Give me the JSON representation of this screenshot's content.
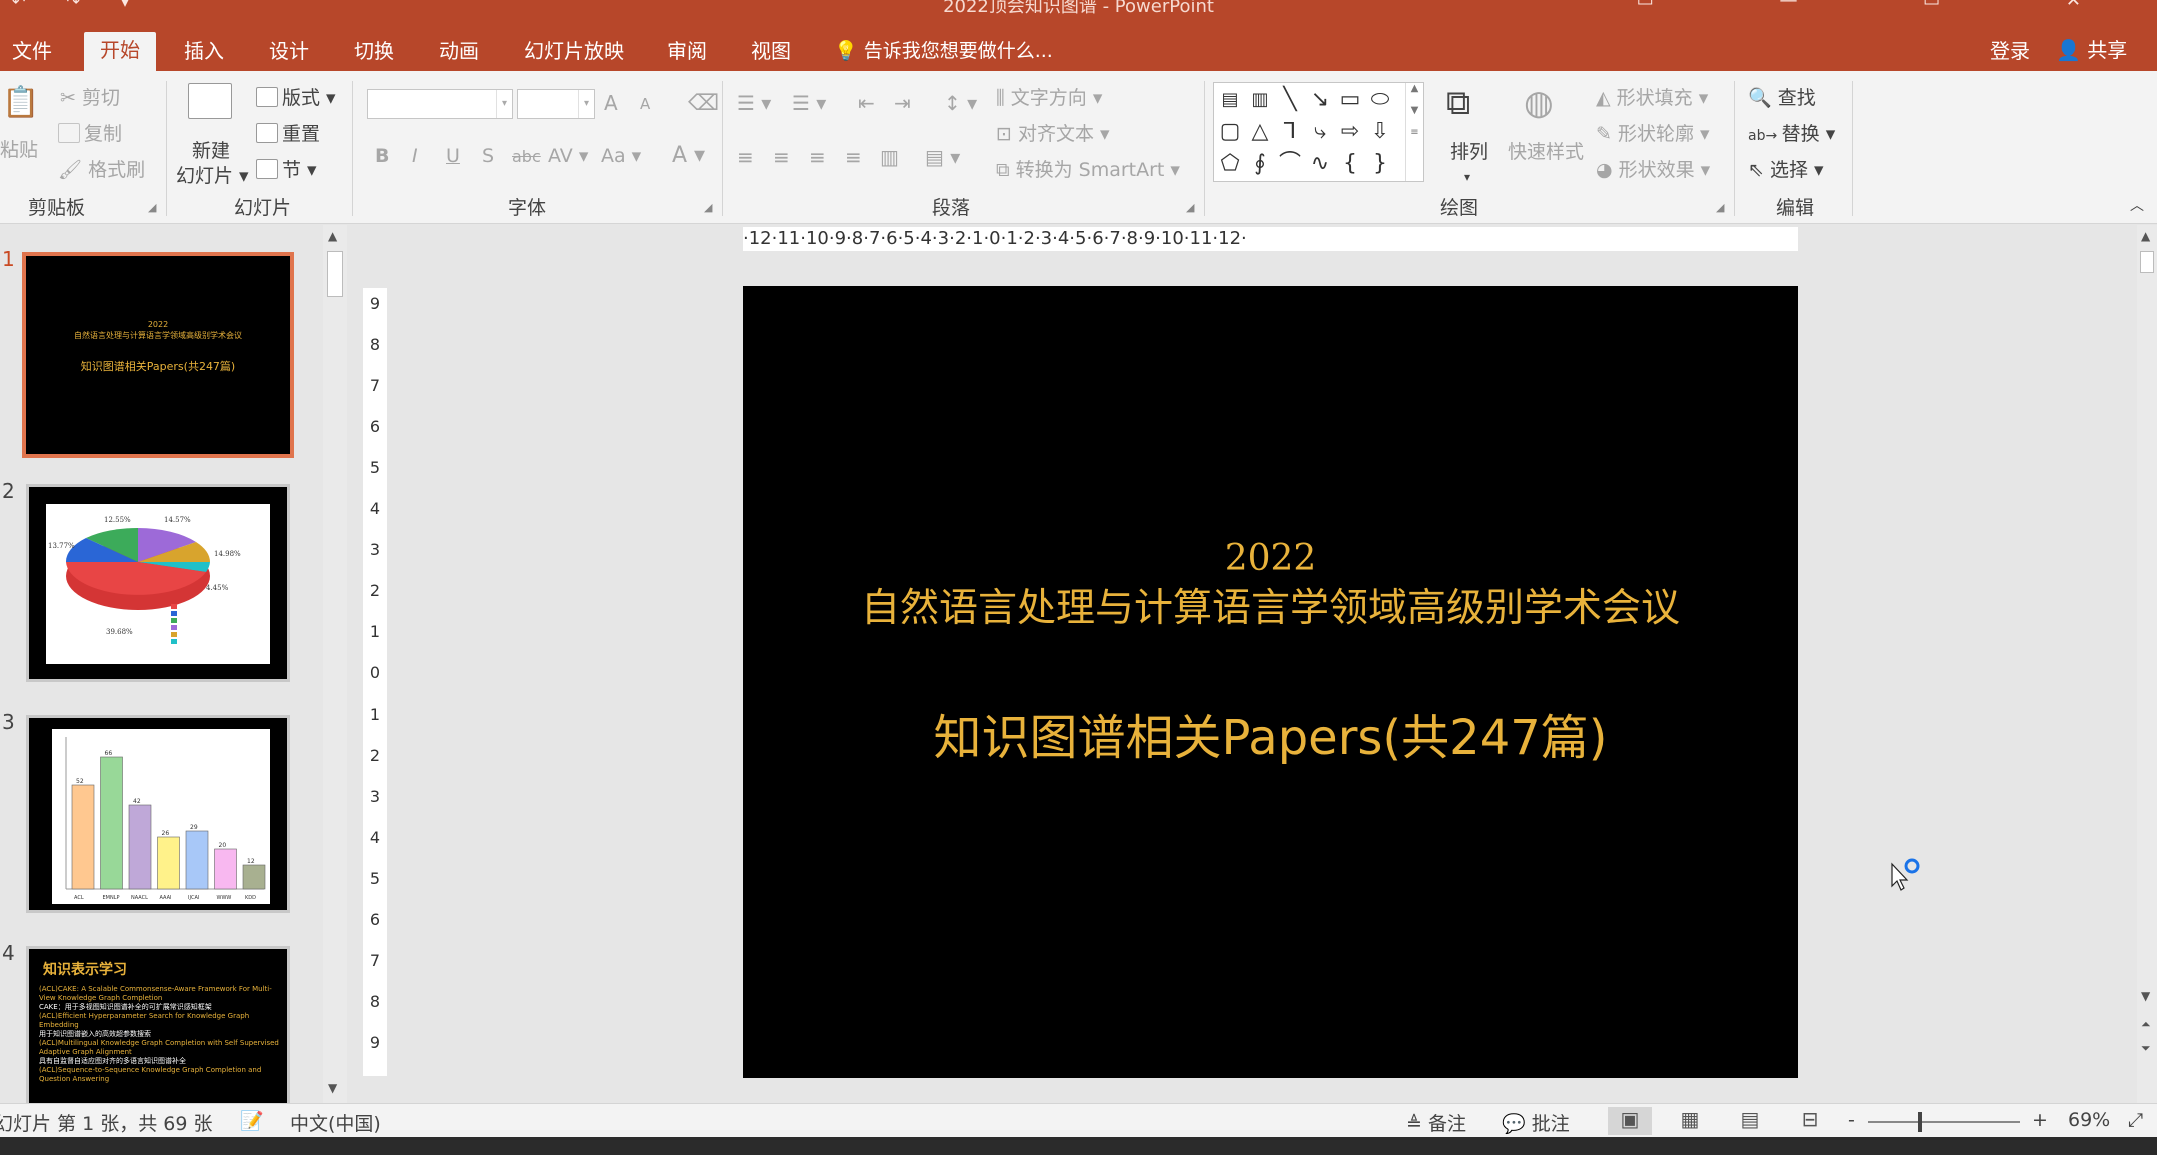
{
  "window": {
    "title": "2022顶会知识图谱 - PowerPoint",
    "quick_access": "↶ ↷ ▾",
    "controls": "▭ — ▭ ✕"
  },
  "tabs": [
    "文件",
    "开始",
    "插入",
    "设计",
    "切换",
    "动画",
    "幻灯片放映",
    "审阅",
    "视图"
  ],
  "active_tab": "开始",
  "tell_me": "告诉我您想要做什么...",
  "sign_in": "登录",
  "share": "共享",
  "ribbon": {
    "clipboard": {
      "paste": "粘贴",
      "cut": "剪切",
      "copy": "复制",
      "format_painter": "格式刷",
      "label": "剪贴板"
    },
    "slides": {
      "new_slide_1": "新建",
      "new_slide_2": "幻灯片",
      "layout": "版式",
      "reset": "重置",
      "section": "节",
      "label": "幻灯片"
    },
    "font": {
      "label": "字体",
      "bold": "B",
      "italic": "I",
      "underline": "U",
      "shadow": "S",
      "strike": "abc",
      "spacing": "AV",
      "case": "Aa",
      "color": "A",
      "grow": "A",
      "shrink": "A"
    },
    "paragraph": {
      "label": "段落",
      "text_direction": "文字方向",
      "align_text": "对齐文本",
      "smartart": "转换为 SmartArt"
    },
    "drawing": {
      "label": "绘图",
      "arrange": "排列",
      "quick_styles": "快速样式",
      "shape_fill": "形状填充",
      "shape_outline": "形状轮廓",
      "shape_effects": "形状效果"
    },
    "editing": {
      "label": "编辑",
      "find": "查找",
      "replace": "替换",
      "select": "选择"
    }
  },
  "thumbnails": [
    {
      "num": "1",
      "year": "2022",
      "conf": "自然语言处理与计算语言学领域高级别学术会议",
      "main": "知识图谱相关Papers(共247篇)"
    },
    {
      "num": "2",
      "labels": [
        "12.55%",
        "14.57%",
        "13.77%",
        "14.98%",
        "4.45%",
        "39.68%"
      ]
    },
    {
      "num": "3",
      "values": [
        "52",
        "66",
        "42",
        "26",
        "29",
        "20",
        "12"
      ],
      "cats": [
        "ACL",
        "EMNLP",
        "NAACL",
        "AAAI",
        "IJCAI",
        "WWW",
        "KDD"
      ]
    },
    {
      "num": "4",
      "heading": "知识表示学习",
      "bullets": [
        "(ACL)CAKE: A Scalable Commonsense-Aware Framework For Multi-View Knowledge Graph Completion",
        "CAKE：用于多视图知识图谱补全的可扩展常识感知框架",
        "(ACL)Efficient Hyperparameter Search for Knowledge Graph Embedding",
        "用于知识图谱嵌入的高效超参数搜索",
        "(ACL)Multilingual Knowledge Graph Completion with Self Supervised Adaptive Graph Alignment",
        "具有自监督自适应图对齐的多语言知识图谱补全",
        "(ACL)Sequence-to-Sequence Knowledge Graph Completion and Question Answering"
      ]
    }
  ],
  "slide": {
    "year": "2022",
    "conference": "自然语言处理与计算语言学领域高级别学术会议",
    "main_title": "知识图谱相关Papers(共247篇)"
  },
  "ruler": {
    "horizontal": "·12·11·10·9·8·7·6·5·4·3·2·1·0·1·2·3·4·5·6·7·8·9·10·11·12·",
    "vertical": [
      "9",
      "8",
      "7",
      "6",
      "5",
      "4",
      "3",
      "2",
      "1",
      "0",
      "1",
      "2",
      "3",
      "4",
      "5",
      "6",
      "7",
      "8",
      "9"
    ]
  },
  "status": {
    "slide_info": "幻灯片 第 1 张，共 69 张",
    "language": "中文(中国)",
    "notes": "备注",
    "comments": "批注",
    "zoom": "69%",
    "zoom_minus": "-",
    "zoom_plus": "+"
  },
  "colors": {
    "accent": "#b7472a",
    "slide_text": "#e8b23b",
    "selected_thumb": "#e0744d"
  }
}
